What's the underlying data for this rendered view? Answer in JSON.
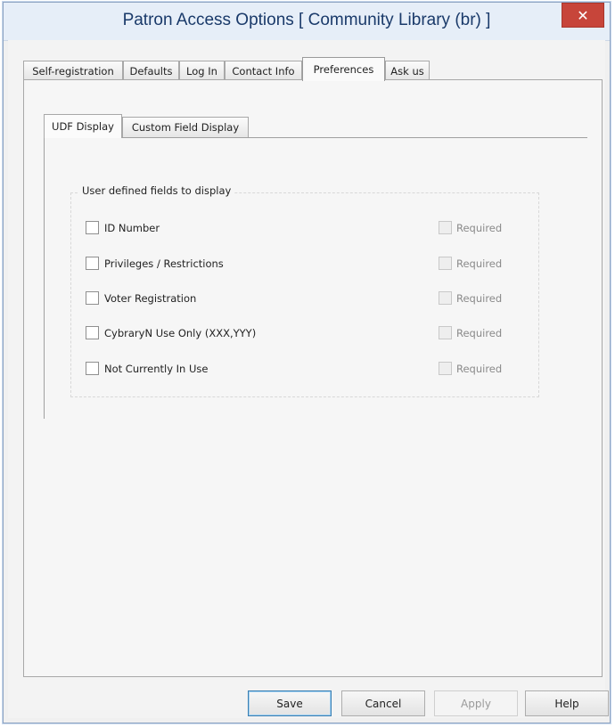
{
  "window": {
    "title": "Patron Access Options [ Community Library  (br) ]",
    "close_glyph": "✕"
  },
  "tabs": [
    {
      "label": "Self-registration",
      "active": false
    },
    {
      "label": "Defaults",
      "active": false
    },
    {
      "label": "Log In",
      "active": false
    },
    {
      "label": "Contact Info",
      "active": false
    },
    {
      "label": "Preferences",
      "active": true
    },
    {
      "label": "Ask us",
      "active": false
    }
  ],
  "inner_tabs": [
    {
      "label": "UDF Display",
      "active": true
    },
    {
      "label": "Custom Field Display",
      "active": false
    }
  ],
  "group": {
    "title": "User defined fields to display",
    "fields": [
      {
        "label": "ID Number",
        "checked": false,
        "required_label": "Required",
        "required_enabled": false
      },
      {
        "label": "Privileges / Restrictions",
        "checked": false,
        "required_label": "Required",
        "required_enabled": false
      },
      {
        "label": "Voter Registration",
        "checked": false,
        "required_label": "Required",
        "required_enabled": false
      },
      {
        "label": "CybraryN Use Only (XXX,YYY)",
        "checked": false,
        "required_label": "Required",
        "required_enabled": false
      },
      {
        "label": "Not Currently In Use",
        "checked": false,
        "required_label": "Required",
        "required_enabled": false
      }
    ]
  },
  "buttons": {
    "save": "Save",
    "cancel": "Cancel",
    "apply": "Apply",
    "help": "Help"
  }
}
